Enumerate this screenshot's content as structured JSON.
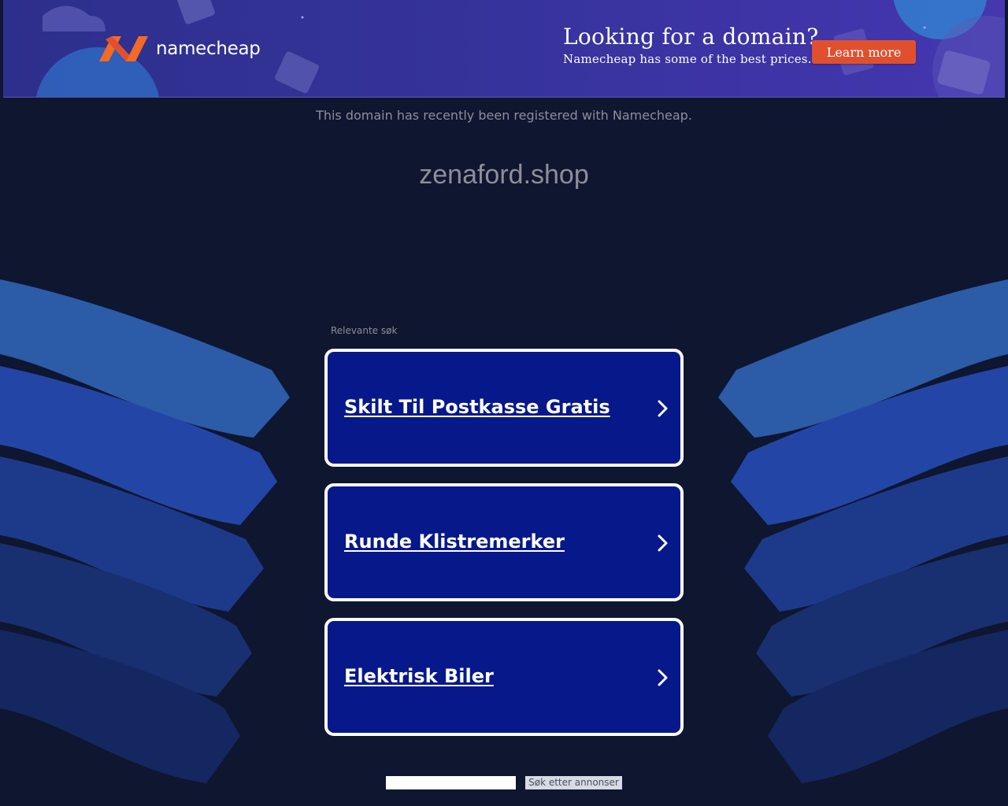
{
  "banner": {
    "logo_text": "namecheap",
    "headline": "Looking for a domain?",
    "subline": "Namecheap has some of the best prices.",
    "cta_label": "Learn more",
    "colors": {
      "cta": "#e0502f",
      "logo_orange": "#f26a25",
      "banner_bg": "#35339a"
    }
  },
  "main": {
    "notice": "This domain has recently been registered with Namecheap.",
    "domain": "zenaford.shop",
    "related_label": "Relevante søk",
    "links": [
      {
        "label": "Skilt Til Postkasse Gratis"
      },
      {
        "label": "Runde Klistremerker"
      },
      {
        "label": "Elektrisk Biler"
      }
    ]
  },
  "search": {
    "input_value": "",
    "button_label": "Søk etter annonser"
  },
  "colors": {
    "page_bg": "#0e1630",
    "card_bg": "#06188a",
    "card_border": "#ffffff",
    "muted_text": "#8d8f98"
  }
}
